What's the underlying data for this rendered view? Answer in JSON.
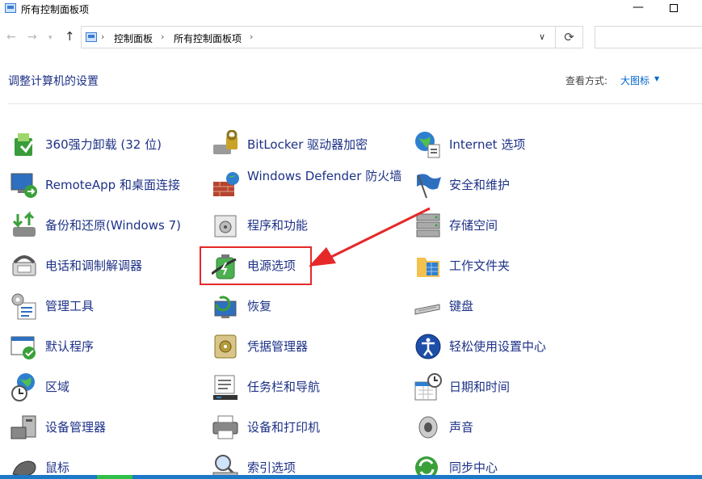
{
  "window": {
    "title": "所有控制面板项"
  },
  "address": {
    "crumbs": [
      "控制面板",
      "所有控制面板项"
    ],
    "separator": "›"
  },
  "header": {
    "title": "调整计算机的设置",
    "view_by_label": "查看方式:",
    "view_by_value": "大图标"
  },
  "items": [
    {
      "label": "360强力卸载 (32 位)",
      "icon": "uninstall-icon"
    },
    {
      "label": "BitLocker 驱动器加密",
      "icon": "bitlocker-icon"
    },
    {
      "label": "Internet 选项",
      "icon": "internet-options-icon"
    },
    {
      "label": "RemoteApp 和桌面连接",
      "icon": "remoteapp-icon"
    },
    {
      "label": "Windows Defender 防火墙",
      "icon": "firewall-icon"
    },
    {
      "label": "安全和维护",
      "icon": "security-flag-icon"
    },
    {
      "label": "备份和还原(Windows 7)",
      "icon": "backup-icon"
    },
    {
      "label": "程序和功能",
      "icon": "programs-icon"
    },
    {
      "label": "存储空间",
      "icon": "storage-icon"
    },
    {
      "label": "电话和调制解调器",
      "icon": "phone-modem-icon"
    },
    {
      "label": "电源选项",
      "icon": "power-options-icon"
    },
    {
      "label": "工作文件夹",
      "icon": "work-folders-icon"
    },
    {
      "label": "管理工具",
      "icon": "admin-tools-icon"
    },
    {
      "label": "恢复",
      "icon": "recovery-icon"
    },
    {
      "label": "键盘",
      "icon": "keyboard-icon"
    },
    {
      "label": "默认程序",
      "icon": "default-programs-icon"
    },
    {
      "label": "凭据管理器",
      "icon": "credential-manager-icon"
    },
    {
      "label": "轻松使用设置中心",
      "icon": "ease-of-access-icon"
    },
    {
      "label": "区域",
      "icon": "region-icon"
    },
    {
      "label": "任务栏和导航",
      "icon": "taskbar-icon"
    },
    {
      "label": "日期和时间",
      "icon": "date-time-icon"
    },
    {
      "label": "设备管理器",
      "icon": "device-manager-icon"
    },
    {
      "label": "设备和打印机",
      "icon": "printer-icon"
    },
    {
      "label": "声音",
      "icon": "sound-icon"
    },
    {
      "label": "鼠标",
      "icon": "mouse-icon"
    },
    {
      "label": "索引选项",
      "icon": "indexing-icon"
    },
    {
      "label": "同步中心",
      "icon": "sync-center-icon"
    }
  ],
  "colors": {
    "link": "#1e3287",
    "highlight": "#e62828",
    "accent": "#0066cc"
  }
}
